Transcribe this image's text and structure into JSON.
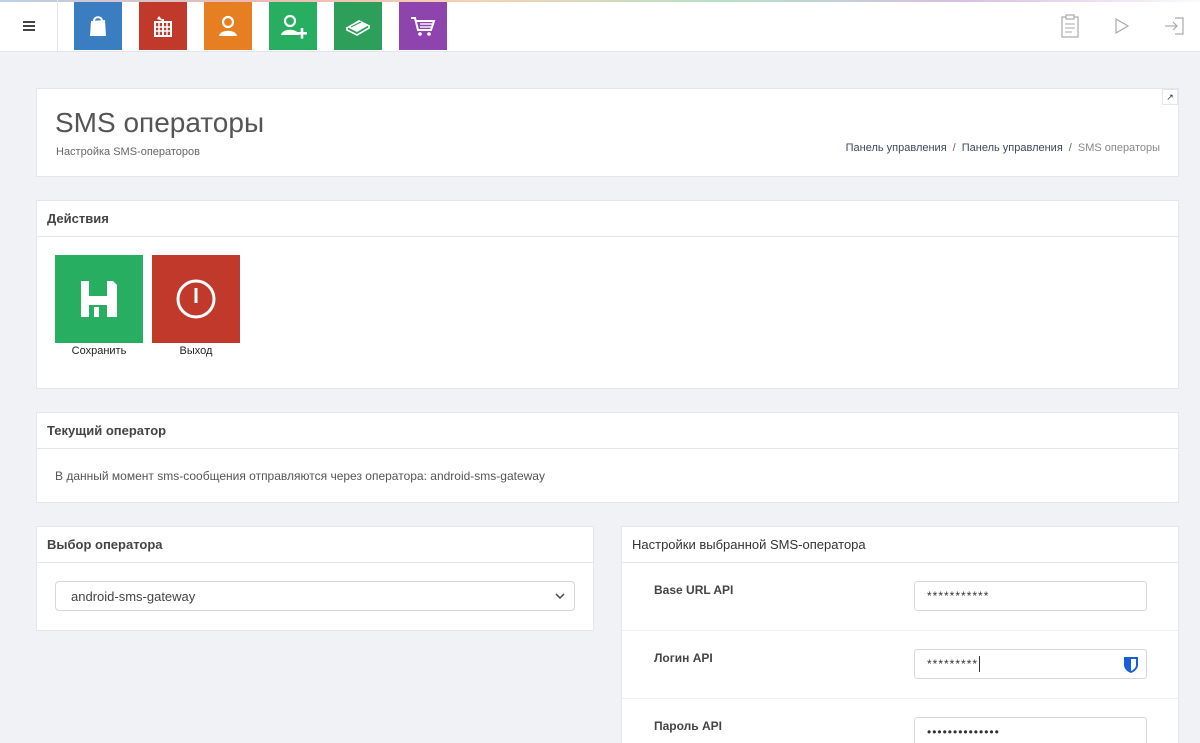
{
  "colors": {
    "blue": "#3b7dc1",
    "red": "#c0392b",
    "orange": "#e67e22",
    "green": "#27ae60",
    "teal": "#2e9e5b",
    "purple": "#8e44ad"
  },
  "toolbar": {
    "menu_icon": "hamburger-icon",
    "apps": [
      {
        "icon": "shopping-bag-icon",
        "color": "#3b7dc1"
      },
      {
        "icon": "gift-icon",
        "color": "#c0392b"
      },
      {
        "icon": "user-icon",
        "color": "#e67e22"
      },
      {
        "icon": "add-user-icon",
        "color": "#27ae60"
      },
      {
        "icon": "book-icon",
        "color": "#2e9e5b"
      },
      {
        "icon": "cart-icon",
        "color": "#8e44ad"
      }
    ],
    "right_tools": [
      "clipboard-icon",
      "play-icon",
      "logout-icon"
    ]
  },
  "header": {
    "title": "SMS операторы",
    "subtitle": "Настройка SMS-операторов",
    "breadcrumb": [
      "Панель управления",
      "Панель управления",
      "SMS операторы"
    ]
  },
  "actions": {
    "title": "Действия",
    "save_label": "Сохранить",
    "exit_label": "Выход"
  },
  "current_operator": {
    "title": "Текущий оператор",
    "text": "В данный момент sms-сообщения отправляются через оператора: android-sms-gateway"
  },
  "operator_select": {
    "title": "Выбор оператора",
    "selected": "android-sms-gateway"
  },
  "operator_settings": {
    "title": "Настройки выбранной SMS-оператора",
    "fields": [
      {
        "label": "Base URL API",
        "value": "***********"
      },
      {
        "label": "Логин API",
        "value": "*********"
      },
      {
        "label": "Пароль API",
        "value": "••••••••••••••"
      }
    ]
  }
}
